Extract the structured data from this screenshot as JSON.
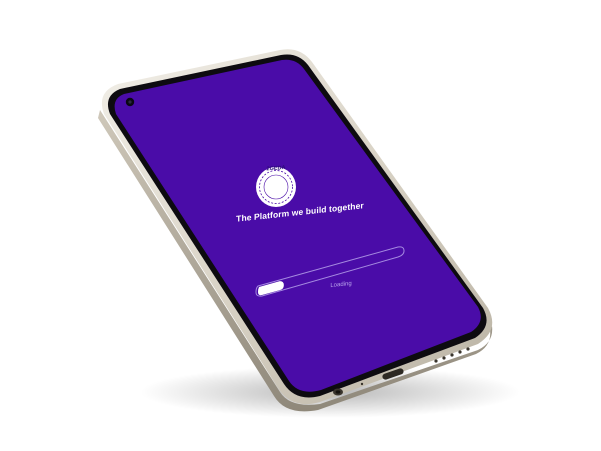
{
  "app": {
    "logo_text": "2GEDA",
    "tagline": "The Platform we build together"
  },
  "loader": {
    "progress_percent": 15,
    "status_text": "Loading"
  },
  "colors": {
    "screen": "#4a0ca8",
    "frame": "#e7e2d8",
    "bezel": "#0d0b10",
    "text": "#ffffff",
    "muted": "#b9a3ec"
  },
  "icons": {
    "camera": "front-camera-icon",
    "logo": "2geda-logo-icon",
    "port": "usb-c-port-icon",
    "jack": "headphone-jack-icon",
    "speaker": "speaker-grille-icon"
  }
}
